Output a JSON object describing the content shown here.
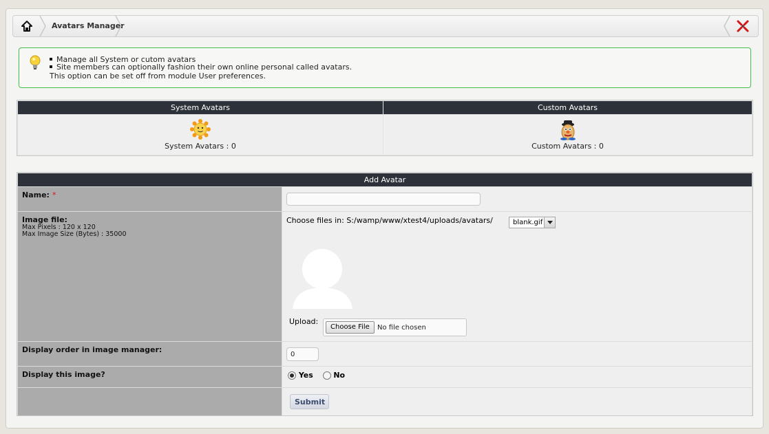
{
  "breadcrumb": {
    "home_icon": "home-icon",
    "current": "Avatars Manager",
    "close_icon": "close-icon"
  },
  "tips": {
    "icon": "lightbulb-icon",
    "items": [
      "Manage all System or cutom avatars",
      "Site members can optionally fashion their own online personal called avatars."
    ],
    "note": "This option can be set off from module User preferences."
  },
  "summary": {
    "system": {
      "header": "System Avatars",
      "count_label": "System Avatars : 0",
      "icon": "sun-icon"
    },
    "custom": {
      "header": "Custom Avatars",
      "count_label": "Custom Avatars : 0",
      "icon": "mr-potato-icon"
    }
  },
  "form": {
    "title": "Add Avatar",
    "name": {
      "label": "Name:",
      "required_mark": "*",
      "value": ""
    },
    "image": {
      "label": "Image file:",
      "max_pixels": "Max Pixels : 120 x 120",
      "max_size": "Max Image Size (Bytes) : 35000",
      "choose_label": "Choose files in: S:/wamp/www/xtest4/uploads/avatars/",
      "selected_file": "blank.gif",
      "upload_label": "Upload:",
      "choose_button": "Choose File",
      "no_file": "No file chosen"
    },
    "order": {
      "label": "Display order in image manager:",
      "value": "0"
    },
    "display": {
      "label": "Display this image?",
      "yes": "Yes",
      "no": "No",
      "selected": "Yes"
    },
    "submit": "Submit"
  },
  "colors": {
    "header_bg": "#2d323a",
    "tips_border": "#42c04a",
    "label_bg": "#ababab",
    "required": "#d11111"
  }
}
